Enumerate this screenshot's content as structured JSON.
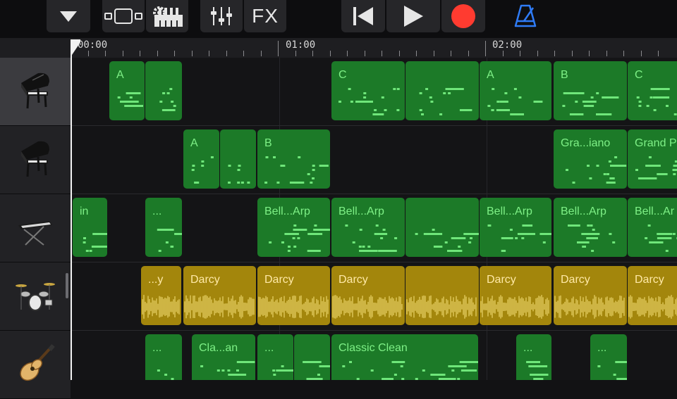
{
  "toolbar": {
    "fx_label": "FX",
    "accent_colors": {
      "record": "#ff3b30",
      "metronome": "#2f7bf5"
    }
  },
  "ruler": {
    "labels": [
      "00:00",
      "01:00",
      "02:00"
    ]
  },
  "tracks": [
    {
      "instrument": "grand-piano",
      "selected": true,
      "regions": [
        {
          "label": "A",
          "type": "midi"
        },
        {
          "label": "",
          "type": "midi"
        },
        {
          "label": "C",
          "type": "midi"
        },
        {
          "label": "",
          "type": "midi"
        },
        {
          "label": "A",
          "type": "midi"
        },
        {
          "label": "B",
          "type": "midi"
        },
        {
          "label": "C",
          "type": "midi"
        }
      ]
    },
    {
      "instrument": "grand-piano",
      "selected": false,
      "regions": [
        {
          "label": "A",
          "type": "midi"
        },
        {
          "label": "",
          "type": "midi"
        },
        {
          "label": "B",
          "type": "midi"
        },
        {
          "label": "Gra...iano",
          "type": "midi"
        },
        {
          "label": "Grand P",
          "type": "midi"
        }
      ]
    },
    {
      "instrument": "synth-keyboard",
      "selected": false,
      "regions": [
        {
          "label": "in",
          "type": "midi"
        },
        {
          "label": "...",
          "type": "midi"
        },
        {
          "label": "Bell...Arp",
          "type": "midi"
        },
        {
          "label": "Bell...Arp",
          "type": "midi"
        },
        {
          "label": "",
          "type": "midi"
        },
        {
          "label": "Bell...Arp",
          "type": "midi"
        },
        {
          "label": "Bell...Arp",
          "type": "midi"
        },
        {
          "label": "Bell...Ar",
          "type": "midi"
        }
      ]
    },
    {
      "instrument": "drum-kit",
      "selected": false,
      "regions": [
        {
          "label": "...y",
          "type": "audio"
        },
        {
          "label": "Darcy",
          "type": "audio"
        },
        {
          "label": "Darcy",
          "type": "audio"
        },
        {
          "label": "Darcy",
          "type": "audio"
        },
        {
          "label": "",
          "type": "audio"
        },
        {
          "label": "Darcy",
          "type": "audio"
        },
        {
          "label": "Darcy",
          "type": "audio"
        },
        {
          "label": "Darcy",
          "type": "audio"
        }
      ]
    },
    {
      "instrument": "electric-guitar",
      "selected": false,
      "regions": [
        {
          "label": "...",
          "type": "midi"
        },
        {
          "label": "Cla...an",
          "type": "midi"
        },
        {
          "label": "...",
          "type": "midi"
        },
        {
          "label": "",
          "type": "midi"
        },
        {
          "label": "Classic Clean",
          "type": "midi"
        },
        {
          "label": "...",
          "type": "midi"
        },
        {
          "label": "...",
          "type": "midi"
        }
      ]
    }
  ]
}
